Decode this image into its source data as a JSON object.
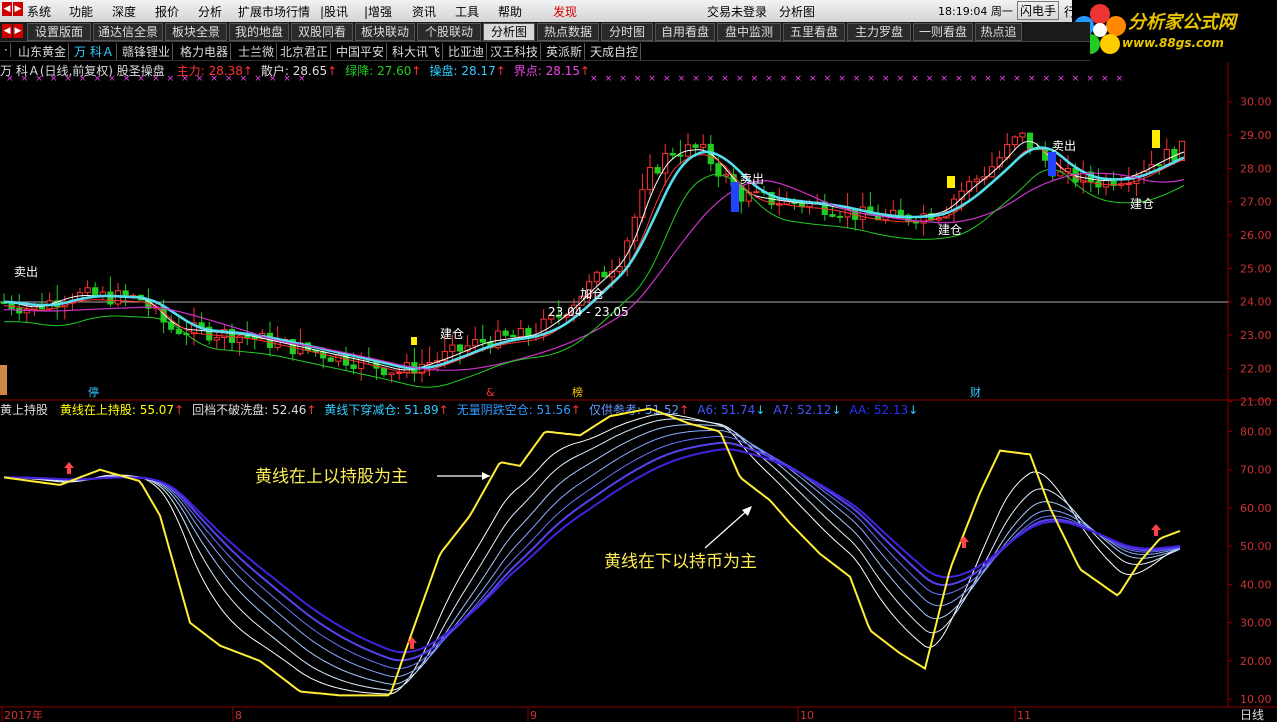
{
  "menu": {
    "items": [
      "系统",
      "功能",
      "深度",
      "报价",
      "分析",
      "扩展市场行情",
      "|股讯",
      "|增强",
      "资讯",
      "工具",
      "帮助",
      "发现"
    ],
    "login_status": "交易未登录",
    "view_title": "分析图",
    "time": "18:19:04 周一",
    "flash_button": "闪电手",
    "row_button": "行"
  },
  "logo": {
    "name": "分析家公式网",
    "url": "www.88gs.com"
  },
  "tabs": [
    "设置版面",
    "通达信全景",
    "板块全景",
    "我的地盘",
    "双股同看",
    "板块联动",
    "个股联动",
    "分析图",
    "热点数据",
    "分时图",
    "自用看盘",
    "盘中监测",
    "五里看盘",
    "主力罗盘",
    "一则看盘",
    "热点追"
  ],
  "active_tab": "分析图",
  "stocks": [
    "·",
    "山东黄金",
    "万 科Ａ",
    "赣锋锂业",
    "格力电器",
    "士兰微",
    "北京君正",
    "中国平安",
    "科大讯飞",
    "比亚迪",
    "汉王科技",
    "英派斯",
    "天成自控"
  ],
  "current_stock": "万 科Ａ",
  "main_indicator": {
    "title": "万 科Ａ(日线,前复权) 股圣操盘",
    "values": [
      {
        "label": "主力:",
        "value": "28.38",
        "arrow": "↑",
        "color": "#ff3333"
      },
      {
        "label": "散户:",
        "value": "28.65",
        "arrow": "↑",
        "color": "#dddddd"
      },
      {
        "label": "绿降:",
        "value": "27.60",
        "arrow": "↑",
        "color": "#22cc22"
      },
      {
        "label": "操盘:",
        "value": "28.17",
        "arrow": "↑",
        "color": "#33ccff"
      },
      {
        "label": "界点:",
        "value": "28.15",
        "arrow": "↑",
        "color": "#ee44ee"
      }
    ]
  },
  "sub_indicator": {
    "title": "黄上持股",
    "values": [
      {
        "label": "黄线在上持股:",
        "value": "55.07",
        "arrow": "↑",
        "color": "#ffff00"
      },
      {
        "label": "回档不破洗盘:",
        "value": "52.46",
        "arrow": "↑",
        "color": "#dddddd"
      },
      {
        "label": "黄线下穿减仓:",
        "value": "51.89",
        "arrow": "↑",
        "color": "#33ccff"
      },
      {
        "label": "无量阴跌空仓:",
        "value": "51.56",
        "arrow": "↑",
        "color": "#3399ff"
      },
      {
        "label": "仅供参考:",
        "value": "51.52",
        "arrow": "↑",
        "color": "#6699ff"
      },
      {
        "label": "A6:",
        "value": "51.74",
        "arrow": "↓",
        "color": "#4455ff"
      },
      {
        "label": "A7:",
        "value": "52.12",
        "arrow": "↓",
        "color": "#4455ff"
      },
      {
        "label": "AA:",
        "value": "52.13",
        "arrow": "↓",
        "color": "#2233ff"
      }
    ]
  },
  "annotations": {
    "main": [
      "卖出",
      "建仓",
      "加仓",
      "23.04 - 23.05",
      "卖出",
      "建仓",
      "卖出",
      "建仓"
    ],
    "events": [
      "停",
      "&",
      "榜",
      "财"
    ],
    "sub": [
      "黄线在上以持股为主",
      "黄线在下以持币为主"
    ]
  },
  "price_axis": [
    "30.00",
    "29.00",
    "28.00",
    "27.00",
    "26.00",
    "25.00",
    "24.00",
    "23.00",
    "22.00",
    "21.00"
  ],
  "osc_axis": [
    "80.00",
    "70.00",
    "60.00",
    "50.00",
    "40.00",
    "30.00",
    "20.00",
    "10.00"
  ],
  "date_axis": [
    {
      "label": "2017年"
    },
    {
      "label": "8"
    },
    {
      "label": "9"
    },
    {
      "label": "10"
    },
    {
      "label": "11"
    }
  ],
  "period": "日线",
  "colors": {
    "up": "#ff3333",
    "down": "#22cc22",
    "ma_cyan": "#55ddee",
    "ma_white": "#ffffff",
    "ma_magenta": "#cc33cc",
    "yellow": "#ffee33"
  }
}
